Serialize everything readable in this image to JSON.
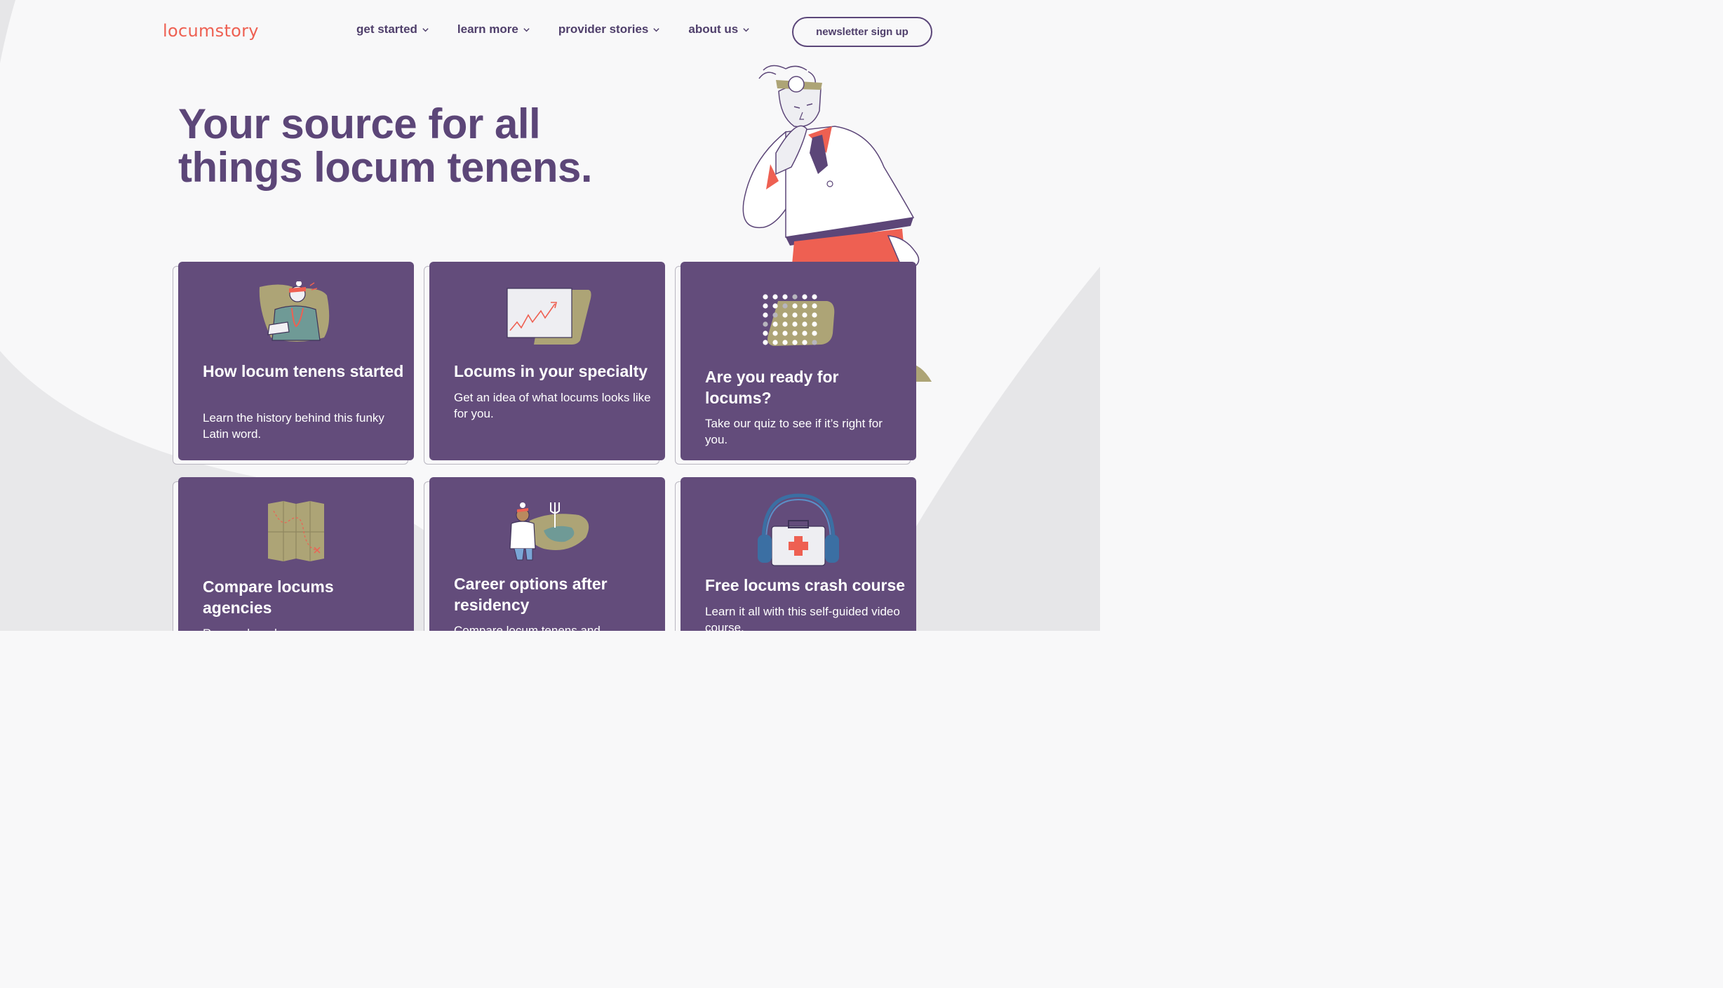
{
  "header": {
    "logo": "locumstory",
    "nav": [
      {
        "label": "get started"
      },
      {
        "label": "learn more"
      },
      {
        "label": "provider stories"
      },
      {
        "label": "about us"
      }
    ],
    "newsletter_label": "newsletter sign up"
  },
  "hero": {
    "title": "Your source for all things locum tenens."
  },
  "cards": [
    {
      "title": "How locum tenens started",
      "description": "Learn the history behind this funky Latin word.",
      "icon": "doctor-with-stethoscope-icon"
    },
    {
      "title": "Locums in your specialty",
      "description": "Get an idea of what locums looks like for you.",
      "icon": "growth-chart-icon"
    },
    {
      "title": "Are you ready for locums?",
      "description": "Take our quiz to see if it’s right for you.",
      "icon": "dot-grid-icon"
    },
    {
      "title": "Compare locums agencies",
      "description": "Research and compare",
      "icon": "map-icon"
    },
    {
      "title": "Career options after residency",
      "description": "Compare locum tenens and",
      "icon": "doctor-at-crossroads-icon"
    },
    {
      "title": "Free locums crash course",
      "description": "Learn it all with this self-guided video course.",
      "icon": "headphones-first-aid-kit-icon"
    }
  ],
  "colors": {
    "brand_coral": "#ee6052",
    "brand_purple": "#5c4678",
    "card_purple": "#634c7b",
    "accent_olive": "#ada476",
    "background": "#f8f8f9"
  }
}
